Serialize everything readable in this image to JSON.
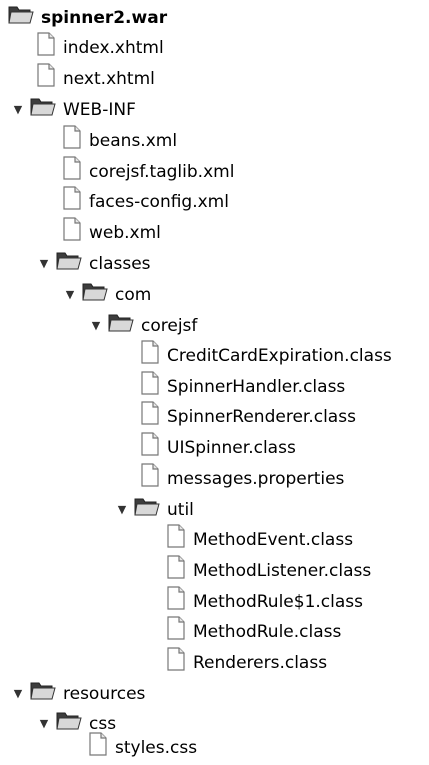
{
  "tree": {
    "root": {
      "label": "spinner2.war",
      "icon": "folder-open-icon"
    },
    "items": [
      {
        "label": "index.xhtml",
        "icon": "file-icon"
      },
      {
        "label": "next.xhtml",
        "icon": "file-icon"
      },
      {
        "label": "WEB-INF",
        "icon": "folder-open-icon",
        "expanded": true
      },
      {
        "label": "beans.xml",
        "icon": "file-icon"
      },
      {
        "label": "corejsf.taglib.xml",
        "icon": "file-icon"
      },
      {
        "label": "faces-config.xml",
        "icon": "file-icon"
      },
      {
        "label": "web.xml",
        "icon": "file-icon"
      },
      {
        "label": "classes",
        "icon": "folder-open-icon",
        "expanded": true
      },
      {
        "label": "com",
        "icon": "folder-open-icon",
        "expanded": true
      },
      {
        "label": "corejsf",
        "icon": "folder-open-icon",
        "expanded": true
      },
      {
        "label": "CreditCardExpiration.class",
        "icon": "file-icon"
      },
      {
        "label": "SpinnerHandler.class",
        "icon": "file-icon"
      },
      {
        "label": "SpinnerRenderer.class",
        "icon": "file-icon"
      },
      {
        "label": "UISpinner.class",
        "icon": "file-icon"
      },
      {
        "label": "messages.properties",
        "icon": "file-icon"
      },
      {
        "label": "util",
        "icon": "folder-open-icon",
        "expanded": true
      },
      {
        "label": "MethodEvent.class",
        "icon": "file-icon"
      },
      {
        "label": "MethodListener.class",
        "icon": "file-icon"
      },
      {
        "label": "MethodRule$1.class",
        "icon": "file-icon"
      },
      {
        "label": "MethodRule.class",
        "icon": "file-icon"
      },
      {
        "label": "Renderers.class",
        "icon": "file-icon"
      },
      {
        "label": "resources",
        "icon": "folder-open-icon",
        "expanded": true
      },
      {
        "label": "css",
        "icon": "folder-open-icon",
        "expanded": true
      },
      {
        "label": "styles.css",
        "icon": "file-icon"
      }
    ]
  }
}
